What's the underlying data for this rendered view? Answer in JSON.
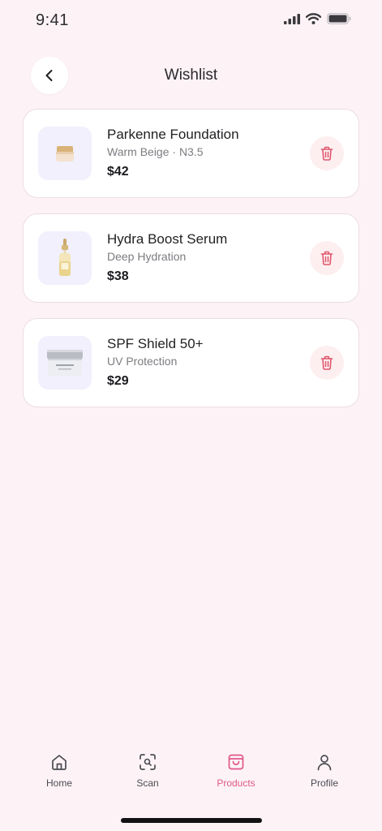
{
  "status": {
    "time": "9:41"
  },
  "header": {
    "title": "Wishlist"
  },
  "items": [
    {
      "name": "Parkenne Foundation",
      "variant": "Warm Beige · N3.5",
      "price": "$42",
      "thumb": "jar-icon"
    },
    {
      "name": "Hydra Boost Serum",
      "variant": "Deep Hydration",
      "price": "$38",
      "thumb": "dropper-bottle-icon"
    },
    {
      "name": "SPF Shield 50+",
      "variant": "UV Protection",
      "price": "$29",
      "thumb": "cream-tub-icon"
    }
  ],
  "tabs": [
    {
      "label": "Home",
      "icon": "home-icon",
      "active": false
    },
    {
      "label": "Scan",
      "icon": "scan-icon",
      "active": false
    },
    {
      "label": "Products",
      "icon": "shopping-bag-icon",
      "active": true
    },
    {
      "label": "Profile",
      "icon": "user-icon",
      "active": false
    }
  ],
  "colors": {
    "accent": "#e0578a",
    "delete": "#e0566b",
    "background": "#fdf3f6"
  }
}
